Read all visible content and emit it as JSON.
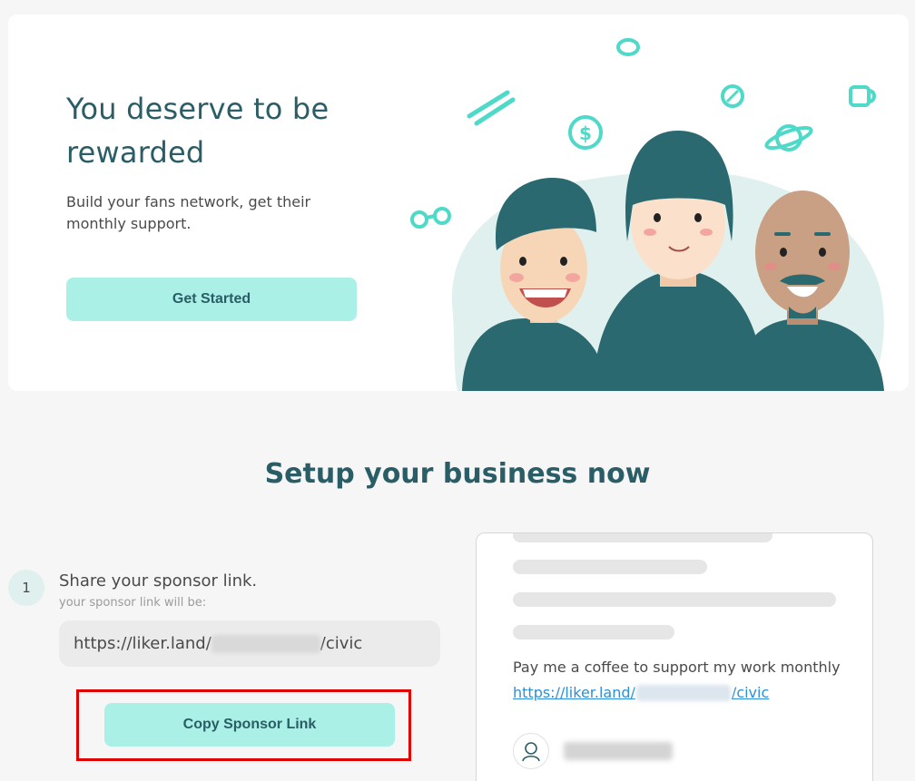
{
  "hero": {
    "title": "You deserve to be rewarded",
    "subtitle": "Build your fans network, get their monthly support.",
    "cta_label": "Get Started"
  },
  "setup": {
    "title": "Setup your business now",
    "step": {
      "number": "1",
      "title": "Share your sponsor link.",
      "hint": "your sponsor link will be:",
      "link_prefix": "https://liker.land/",
      "link_suffix": "/civic",
      "copy_label": "Copy Sponsor Link"
    }
  },
  "preview": {
    "message": "Pay me a coffee to support my work monthly",
    "link_prefix": "https://liker.land/",
    "link_suffix": "/civic"
  },
  "colors": {
    "accent": "#aaf0e6",
    "brand_dark": "#2a5d66",
    "highlight": "#e00000"
  }
}
